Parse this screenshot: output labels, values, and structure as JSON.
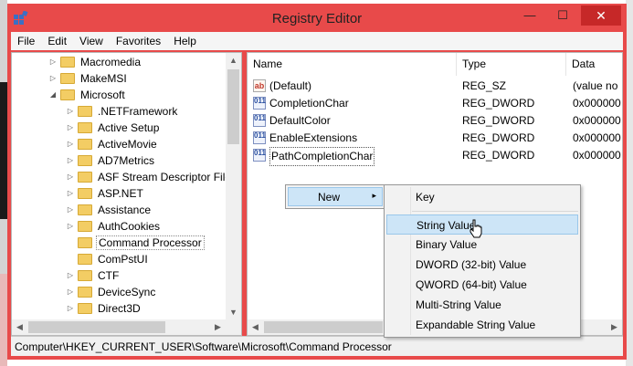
{
  "window": {
    "title": "Registry Editor",
    "minimize": "—",
    "maximize": "☐",
    "close": "✕"
  },
  "menu": [
    "File",
    "Edit",
    "View",
    "Favorites",
    "Help"
  ],
  "tree": [
    {
      "label": "Macromedia",
      "expander": "▷"
    },
    {
      "label": "MakeMSI",
      "expander": "▷"
    },
    {
      "label": "Microsoft",
      "expander": "◢"
    },
    {
      "label": ".NETFramework",
      "expander": "▷"
    },
    {
      "label": "Active Setup",
      "expander": "▷"
    },
    {
      "label": "ActiveMovie",
      "expander": "▷"
    },
    {
      "label": "AD7Metrics",
      "expander": "▷"
    },
    {
      "label": "ASF Stream Descriptor File",
      "expander": "▷"
    },
    {
      "label": "ASP.NET",
      "expander": "▷"
    },
    {
      "label": "Assistance",
      "expander": "▷"
    },
    {
      "label": "AuthCookies",
      "expander": "▷"
    },
    {
      "label": "Command Processor",
      "expander": ""
    },
    {
      "label": "ComPstUI",
      "expander": ""
    },
    {
      "label": "CTF",
      "expander": "▷"
    },
    {
      "label": "DeviceSync",
      "expander": "▷"
    },
    {
      "label": "Direct3D",
      "expander": "▷"
    }
  ],
  "columns": {
    "name": "Name",
    "type": "Type",
    "data": "Data"
  },
  "values": [
    {
      "name": "(Default)",
      "type": "REG_SZ",
      "data": "(value no",
      "icon": "string-value-icon",
      "badge": "ab"
    },
    {
      "name": "CompletionChar",
      "type": "REG_DWORD",
      "data": "0x000000",
      "icon": "binary-value-icon",
      "badge": "011"
    },
    {
      "name": "DefaultColor",
      "type": "REG_DWORD",
      "data": "0x000000",
      "icon": "binary-value-icon",
      "badge": "011"
    },
    {
      "name": "EnableExtensions",
      "type": "REG_DWORD",
      "data": "0x000000",
      "icon": "binary-value-icon",
      "badge": "011"
    },
    {
      "name": "PathCompletionChar",
      "type": "REG_DWORD",
      "data": "0x000000",
      "icon": "binary-value-icon",
      "badge": "011"
    }
  ],
  "context_menu": {
    "new_label": "New",
    "arrow": "▸"
  },
  "new_submenu": [
    "Key",
    "String Value",
    "Binary Value",
    "DWORD (32-bit) Value",
    "QWORD (64-bit) Value",
    "Multi-String Value",
    "Expandable String Value"
  ],
  "highlighted_submenu_item": "String Value",
  "statusbar": {
    "path": "Computer\\HKEY_CURRENT_USER\\Software\\Microsoft\\Command Processor"
  },
  "colors": {
    "window_frame": "#e84a4a",
    "close_button": "#c62828",
    "menu_highlight": "#cde5f7",
    "folder": "#f3cd64"
  }
}
